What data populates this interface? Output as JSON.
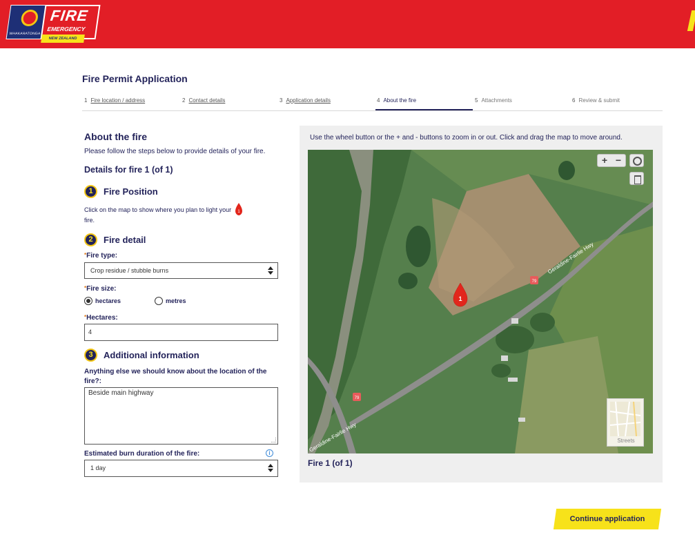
{
  "header": {
    "logo_crest_text": "WHAKARATONGA IWI",
    "logo_title": "FIRE",
    "logo_subtitle": "EMERGENCY",
    "logo_country": "NEW ZEALAND",
    "brand_red": "#e21e26",
    "brand_yellow": "#f7e21a",
    "brand_navy": "#23235a"
  },
  "page": {
    "title": "Fire Permit Application"
  },
  "stepper": {
    "steps": [
      {
        "num": "1",
        "label": "Fire location / address",
        "state": "done"
      },
      {
        "num": "2",
        "label": "Contact details",
        "state": "done"
      },
      {
        "num": "3",
        "label": "Application details",
        "state": "done"
      },
      {
        "num": "4",
        "label": "About the fire",
        "state": "current"
      },
      {
        "num": "5",
        "label": "Attachments",
        "state": "future"
      },
      {
        "num": "6",
        "label": "Review & submit",
        "state": "future"
      }
    ]
  },
  "form": {
    "heading": "About the fire",
    "intro": "Please follow the steps below to provide details of your fire.",
    "details_heading": "Details for fire 1 (of 1)",
    "sections": [
      {
        "num": "1",
        "title": "Fire Position"
      },
      {
        "num": "2",
        "title": "Fire detail"
      },
      {
        "num": "3",
        "title": "Additional information"
      }
    ],
    "position_text": "Click on the map to show where you plan to light your",
    "position_text_tail": "fire.",
    "position_marker": "1",
    "required_marker": "*",
    "fire_type_label": "Fire type:",
    "fire_type_value": "Crop residue / stubble burns",
    "fire_size_label": "Fire size:",
    "size_options": [
      {
        "label": "hectares",
        "selected": true
      },
      {
        "label": "metres",
        "selected": false
      }
    ],
    "hectares_label": "Hectares:",
    "hectares_value": "4",
    "additional_label": "Anything else we should know about the location of the fire?:",
    "additional_value": "Beside main highway",
    "duration_label": "Estimated burn duration of the fire:",
    "info_icon": "i",
    "duration_value": "1 day"
  },
  "map": {
    "instructions": "Use the wheel button or the + and - buttons to zoom in or out. Click and drag the map to move around.",
    "zoom_in": "+",
    "zoom_out": "−",
    "road_label_upper": "Geraldine-Fairlie Hwy",
    "road_label_lower": "Geraldine-Fairlie Hwy",
    "route_shield": "79",
    "fire_marker": "1",
    "basemap_toggle": "Streets",
    "caption": "Fire 1 (of 1)"
  },
  "actions": {
    "continue_label": "Continue application"
  }
}
